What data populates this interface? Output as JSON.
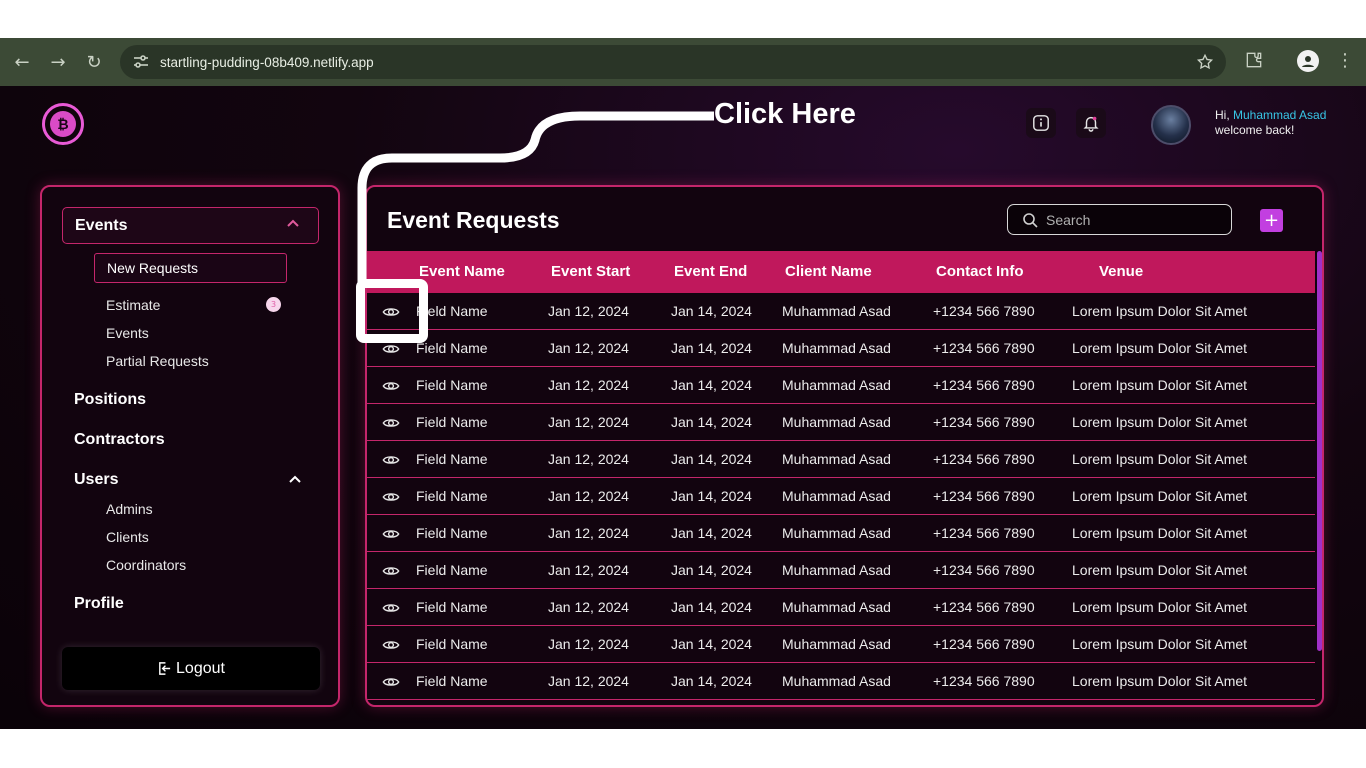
{
  "browser": {
    "url": "startling-pudding-08b409.netlify.app"
  },
  "header": {
    "greeting_prefix": "Hi, ",
    "user_name": "Muhammad Asad",
    "welcome": "welcome back!"
  },
  "sidebar": {
    "events_label": "Events",
    "events_sub": [
      "New Requests",
      "Estimate",
      "Events",
      "Partial Requests"
    ],
    "estimate_badge": "3",
    "positions": "Positions",
    "contractors": "Contractors",
    "users": "Users",
    "users_sub": [
      "Admins",
      "Clients",
      "Coordinators"
    ],
    "profile": "Profile",
    "logout": "Logout"
  },
  "main": {
    "title": "Event Requests",
    "search_placeholder": "Search",
    "add_label": "+",
    "columns": [
      "Event Name",
      "Event Start",
      "Event End",
      "Client Name",
      "Contact Info",
      "Venue"
    ],
    "rows": [
      [
        "Field Name",
        "Jan 12, 2024",
        "Jan 14, 2024",
        "Muhammad Asad",
        "+1234 566 7890",
        "Lorem Ipsum Dolor Sit Amet"
      ],
      [
        "Field Name",
        "Jan 12, 2024",
        "Jan 14, 2024",
        "Muhammad Asad",
        "+1234 566 7890",
        "Lorem Ipsum Dolor Sit Amet"
      ],
      [
        "Field Name",
        "Jan 12, 2024",
        "Jan 14, 2024",
        "Muhammad Asad",
        "+1234 566 7890",
        "Lorem Ipsum Dolor Sit Amet"
      ],
      [
        "Field Name",
        "Jan 12, 2024",
        "Jan 14, 2024",
        "Muhammad Asad",
        "+1234 566 7890",
        "Lorem Ipsum Dolor Sit Amet"
      ],
      [
        "Field Name",
        "Jan 12, 2024",
        "Jan 14, 2024",
        "Muhammad Asad",
        "+1234 566 7890",
        "Lorem Ipsum Dolor Sit Amet"
      ],
      [
        "Field Name",
        "Jan 12, 2024",
        "Jan 14, 2024",
        "Muhammad Asad",
        "+1234 566 7890",
        "Lorem Ipsum Dolor Sit Amet"
      ],
      [
        "Field Name",
        "Jan 12, 2024",
        "Jan 14, 2024",
        "Muhammad Asad",
        "+1234 566 7890",
        "Lorem Ipsum Dolor Sit Amet"
      ],
      [
        "Field Name",
        "Jan 12, 2024",
        "Jan 14, 2024",
        "Muhammad Asad",
        "+1234 566 7890",
        "Lorem Ipsum Dolor Sit Amet"
      ],
      [
        "Field Name",
        "Jan 12, 2024",
        "Jan 14, 2024",
        "Muhammad Asad",
        "+1234 566 7890",
        "Lorem Ipsum Dolor Sit Amet"
      ],
      [
        "Field Name",
        "Jan 12, 2024",
        "Jan 14, 2024",
        "Muhammad Asad",
        "+1234 566 7890",
        "Lorem Ipsum Dolor Sit Amet"
      ],
      [
        "Field Name",
        "Jan 12, 2024",
        "Jan 14, 2024",
        "Muhammad Asad",
        "+1234 566 7890",
        "Lorem Ipsum Dolor Sit Amet"
      ]
    ]
  },
  "annotation": {
    "text": "Click Here"
  },
  "colors": {
    "accent": "#c4266b",
    "header_row": "#c0185c",
    "add_button": "#c23fe0",
    "link_name": "#38c6e6"
  },
  "icons": [
    "back-arrow-icon",
    "forward-arrow-icon",
    "reload-icon",
    "tune-icon",
    "star-icon",
    "extension-icon",
    "profile-icon",
    "kebab-menu-icon",
    "bitcoin-logo-icon",
    "info-icon",
    "bell-icon",
    "chevron-up-icon",
    "logout-icon",
    "search-icon",
    "plus-icon",
    "eye-icon"
  ]
}
